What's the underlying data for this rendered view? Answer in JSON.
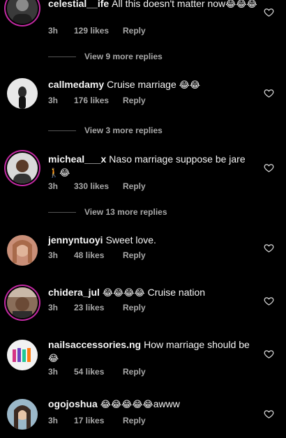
{
  "comments": [
    {
      "username": "celestial__ife",
      "text": "All this doesn't matter now",
      "emoji": "😂😂😂",
      "time": "3h",
      "likes": "129 likes",
      "reply": "Reply",
      "view_more": "View 9 more replies"
    },
    {
      "username": "callmedamy",
      "text": "Cruise marriage",
      "emoji": "😂😂",
      "time": "3h",
      "likes": "176 likes",
      "reply": "Reply",
      "view_more": "View 3 more replies"
    },
    {
      "username": "micheal___x",
      "text": "Naso marriage suppose be jare",
      "emoji": "🚶😂",
      "time": "3h",
      "likes": "330 likes",
      "reply": "Reply",
      "view_more": "View 13 more replies"
    },
    {
      "username": "jennyntuoyi",
      "text": "Sweet love.",
      "emoji": "",
      "time": "3h",
      "likes": "48 likes",
      "reply": "Reply"
    },
    {
      "username": "chidera_jul",
      "text": "Cruise nation",
      "emoji": "😂😂😂😂",
      "time": "3h",
      "likes": "23 likes",
      "reply": "Reply"
    },
    {
      "username": "nailsaccessories.ng",
      "text": "How marriage should be",
      "emoji": "😂",
      "time": "3h",
      "likes": "54 likes",
      "reply": "Reply"
    },
    {
      "username": "ogojoshua",
      "text": "awww",
      "emoji": "😂😂😂😂😂",
      "time": "3h",
      "likes": "17 likes",
      "reply": "Reply"
    }
  ],
  "colors": {
    "background": "#000000",
    "meta": "#a8a8a8",
    "story_ring": "#c32aa3"
  }
}
